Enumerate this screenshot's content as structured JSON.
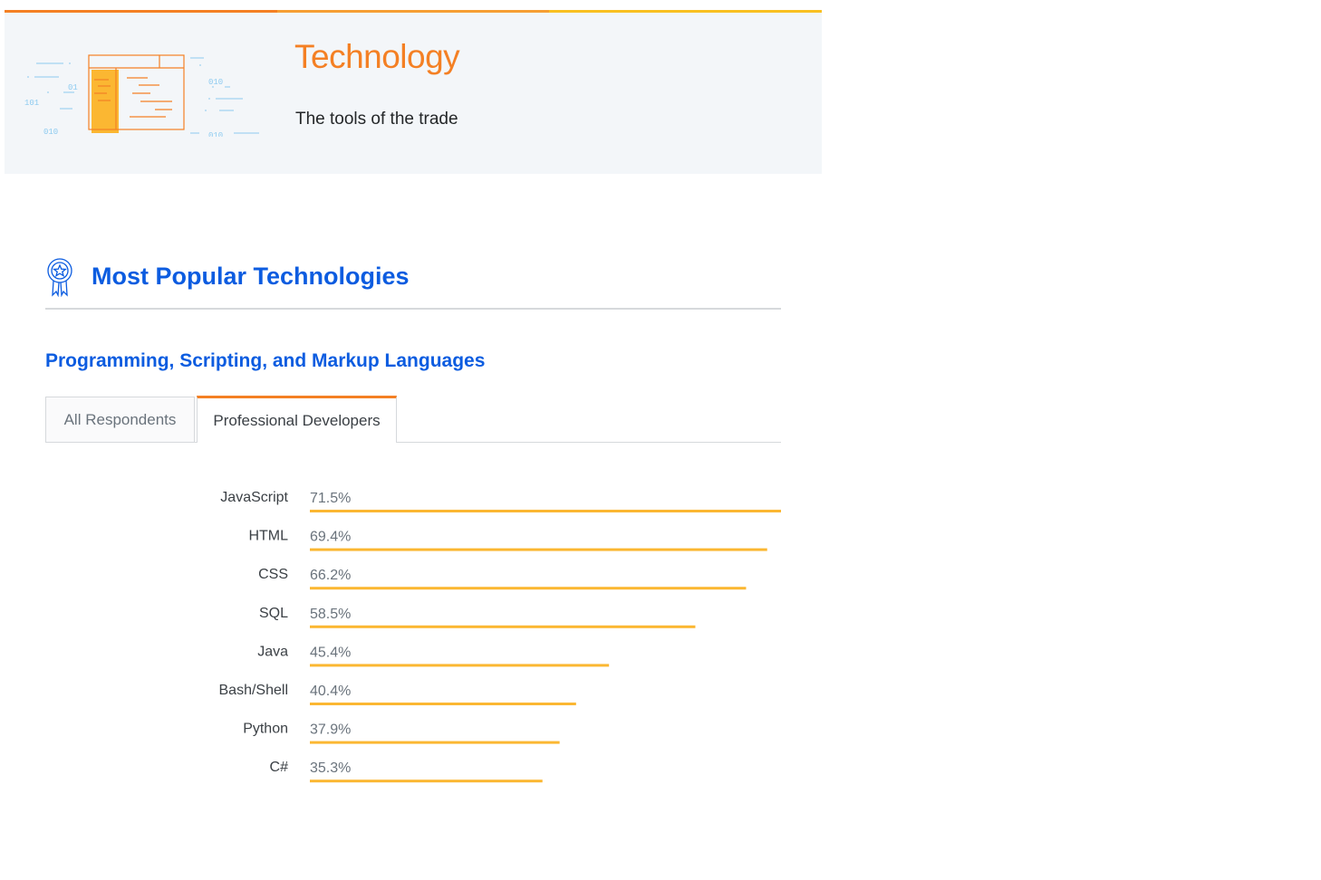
{
  "colors": {
    "stripe": [
      "#f48024",
      "#f69f34",
      "#f9c022"
    ],
    "hero_title": "#f48024",
    "heading_blue": "#0c5ce0",
    "bar": "#fbb732",
    "illus_orange": "#f48024",
    "illus_fill": "#fbb732",
    "illus_blue": "#8ecbf0"
  },
  "hero": {
    "title": "Technology",
    "subtitle": "The tools of the trade",
    "illustration_icon": "code-window-icon",
    "illustration_bits": [
      "01",
      "010",
      "101",
      "010",
      "010"
    ]
  },
  "section": {
    "icon": "award-ribbon-icon",
    "title": "Most Popular Technologies"
  },
  "subsection": {
    "title": "Programming, Scripting, and Markup Languages"
  },
  "tabs": [
    {
      "label": "All Respondents",
      "active": false
    },
    {
      "label": "Professional Developers",
      "active": true
    }
  ],
  "chart_data": {
    "type": "bar",
    "orientation": "horizontal",
    "categories": [
      "JavaScript",
      "HTML",
      "CSS",
      "SQL",
      "Java",
      "Bash/Shell",
      "Python",
      "C#"
    ],
    "values": [
      71.5,
      69.4,
      66.2,
      58.5,
      45.4,
      40.4,
      37.9,
      35.3
    ],
    "value_labels": [
      "71.5%",
      "69.4%",
      "66.2%",
      "58.5%",
      "45.4%",
      "40.4%",
      "37.9%",
      "35.3%"
    ],
    "unit": "%",
    "xlim": [
      0,
      71.5
    ]
  }
}
